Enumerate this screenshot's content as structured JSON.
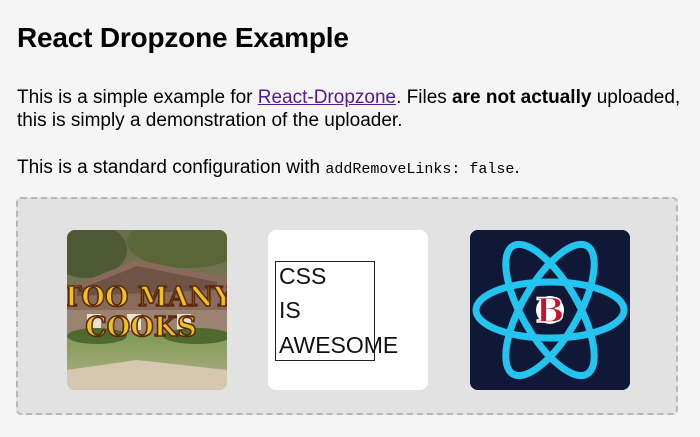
{
  "title": "React Dropzone Example",
  "intro": {
    "prefix": "This is a simple example for ",
    "link_text": "React-Dropzone",
    "middle": ". Files ",
    "bold": "are not actually",
    "suffix": " uploaded, this is simply a demonstration of the uploader."
  },
  "config": {
    "prefix": "This is a standard configuration with ",
    "code": "addRemoveLinks: false",
    "suffix": "."
  },
  "dropzone": {
    "files": [
      {
        "name": "too-many-cooks",
        "text_line1": "TOO MANY",
        "text_line2": "COOKS",
        "icon": "too-many-cooks-image"
      },
      {
        "name": "css-is-awesome",
        "lines": [
          "CSS",
          "IS",
          "AWESOME"
        ],
        "icon": "css-is-awesome-image"
      },
      {
        "name": "react-boston",
        "letter": "B",
        "icon": "react-atom-logo",
        "colors": {
          "atom": "#22c4f0",
          "background": "#101838",
          "badge": "#c8102e"
        }
      }
    ]
  }
}
